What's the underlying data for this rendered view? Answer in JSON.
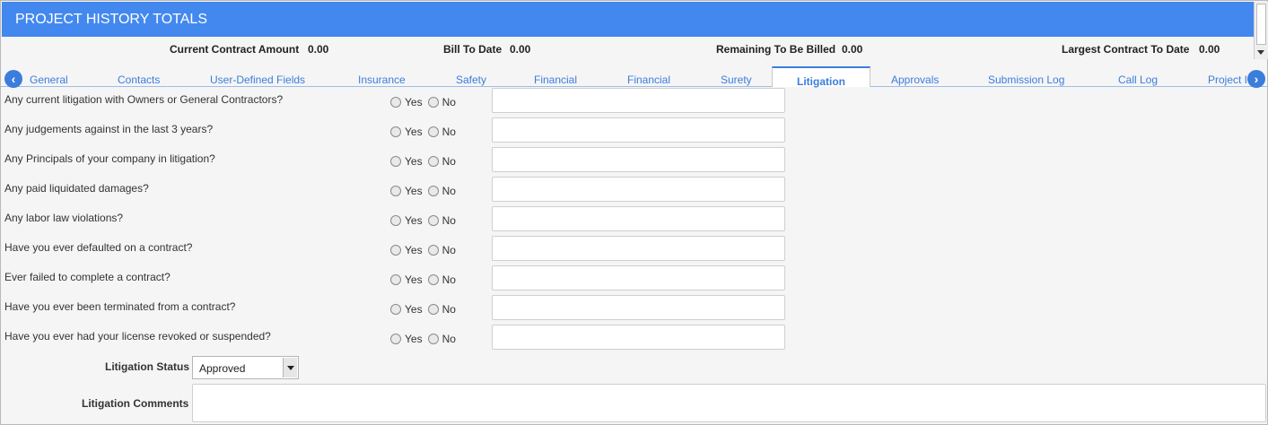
{
  "header": {
    "title": "PROJECT HISTORY TOTALS"
  },
  "totals": [
    {
      "label": "Current Contract Amount",
      "value": "0.00"
    },
    {
      "label": "Bill To Date",
      "value": "0.00"
    },
    {
      "label": "Remaining To Be Billed",
      "value": "0.00"
    },
    {
      "label": "Largest Contract To Date",
      "value": "0.00"
    }
  ],
  "tabs": [
    "General",
    "Contacts",
    "User-Defined Fields",
    "Insurance",
    "Safety",
    "Financial",
    "Financial",
    "Surety",
    "Litigation",
    "Approvals",
    "Submission Log",
    "Call Log",
    "Project I"
  ],
  "active_tab": "Litigation",
  "radio_labels": {
    "yes": "Yes",
    "no": "No"
  },
  "questions": [
    {
      "label": "Any current litigation with Owners or General Contractors?",
      "answer": "",
      "explanation": ""
    },
    {
      "label": "Any judgements against in the last 3 years?",
      "answer": "",
      "explanation": ""
    },
    {
      "label": "Any Principals of your company in litigation?",
      "answer": "",
      "explanation": ""
    },
    {
      "label": "Any paid liquidated damages?",
      "answer": "",
      "explanation": ""
    },
    {
      "label": "Any labor law violations?",
      "answer": "",
      "explanation": ""
    },
    {
      "label": "Have you ever defaulted on a contract?",
      "answer": "",
      "explanation": ""
    },
    {
      "label": "Ever failed to complete a contract?",
      "answer": "",
      "explanation": ""
    },
    {
      "label": "Have you ever been terminated from a contract?",
      "answer": "",
      "explanation": ""
    },
    {
      "label": "Have you ever had your license revoked or suspended?",
      "answer": "",
      "explanation": ""
    }
  ],
  "litigation_status": {
    "label": "Litigation Status",
    "value": "Approved"
  },
  "litigation_comments": {
    "label": "Litigation Comments",
    "value": ""
  },
  "colors": {
    "header_bg": "#4388ef",
    "tab_link": "#3b7ddd"
  }
}
